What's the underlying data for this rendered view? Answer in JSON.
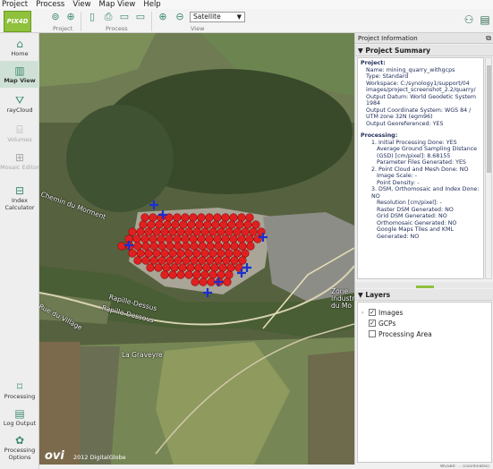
{
  "menu": [
    "Project",
    "Process",
    "View",
    "Map View",
    "Help"
  ],
  "toolbar": {
    "logo_text": "PIX4D",
    "groups": [
      {
        "label": "Project"
      },
      {
        "label": "Process"
      },
      {
        "label": "View"
      }
    ],
    "view_select": "Satellite"
  },
  "sidebar": {
    "items": [
      {
        "label": "Home",
        "icon": "home-icon",
        "state": "normal"
      },
      {
        "label": "Map View",
        "icon": "map-icon",
        "state": "active"
      },
      {
        "label": "rayCloud",
        "icon": "raycloud-icon",
        "state": "normal"
      },
      {
        "label": "Volumes",
        "icon": "volumes-icon",
        "state": "disabled"
      },
      {
        "label": "Mosaic Editor",
        "icon": "mosaic-icon",
        "state": "disabled"
      },
      {
        "label": "Index Calculator",
        "icon": "index-icon",
        "state": "normal"
      },
      {
        "label": "Processing",
        "icon": "processing-icon",
        "state": "normal"
      },
      {
        "label": "Log Output",
        "icon": "log-icon",
        "state": "normal"
      },
      {
        "label": "Processing Options",
        "icon": "gear-icon",
        "state": "normal"
      }
    ]
  },
  "map": {
    "labels": [
      "Chemin du Morment",
      "Rue du Village",
      "Rapille-Dessus",
      "Rapille-Dessous",
      "La Graveyre",
      "Zone Industrielle du Mo"
    ],
    "provider_logo": "ovi",
    "copyright": "2012 DigitalGlobe",
    "marker_color": "#e02020",
    "gcp_color": "#1a2fd0"
  },
  "right_panel": {
    "title": "Project Information",
    "summary_title": "Project Summary",
    "project_heading": "Project:",
    "project_lines": [
      "Name: mining_quarry_withgcps",
      "Type: Standard",
      "Workspace: C:/synology1/support/04 images/project_screenshot_2.2/quarry/",
      "Output Datum: World Geodetic System 1984",
      "Output Coordinate System: WGS 84 / UTM zone 32N (egm96)",
      "Output Georeferenced: YES"
    ],
    "processing_heading": "Processing:",
    "processing_lines": [
      {
        "indent": 1,
        "text": "1. Initial Processing Done: YES"
      },
      {
        "indent": 2,
        "text": "Average Ground Sampling Distance (GSD) [cm/pixel]: 8.68155"
      },
      {
        "indent": 2,
        "text": "Parameter Files Generated: YES"
      },
      {
        "indent": 1,
        "text": "2. Point Cloud and Mesh Done: NO"
      },
      {
        "indent": 2,
        "text": "Image Scale: -"
      },
      {
        "indent": 2,
        "text": "Point Density: -"
      },
      {
        "indent": 1,
        "text": "3. DSM, Orthomosaic and Index Done: NO"
      },
      {
        "indent": 2,
        "text": "Resolution [cm/pixel]: -"
      },
      {
        "indent": 2,
        "text": "Raster DSM Generated: NO"
      },
      {
        "indent": 2,
        "text": "Grid DSM Generated: NO"
      },
      {
        "indent": 2,
        "text": "Orthomosaic Generated: NO"
      },
      {
        "indent": 2,
        "text": "Google Maps Tiles and KML Generated: NO"
      }
    ],
    "layers_title": "Layers",
    "layers": [
      {
        "label": "Images",
        "checked": true,
        "expandable": true
      },
      {
        "label": "GCPs",
        "checked": true,
        "expandable": false
      },
      {
        "label": "Processing Area",
        "checked": false,
        "expandable": false
      }
    ]
  },
  "statusbar": "WGS84: ... (coordinates)"
}
